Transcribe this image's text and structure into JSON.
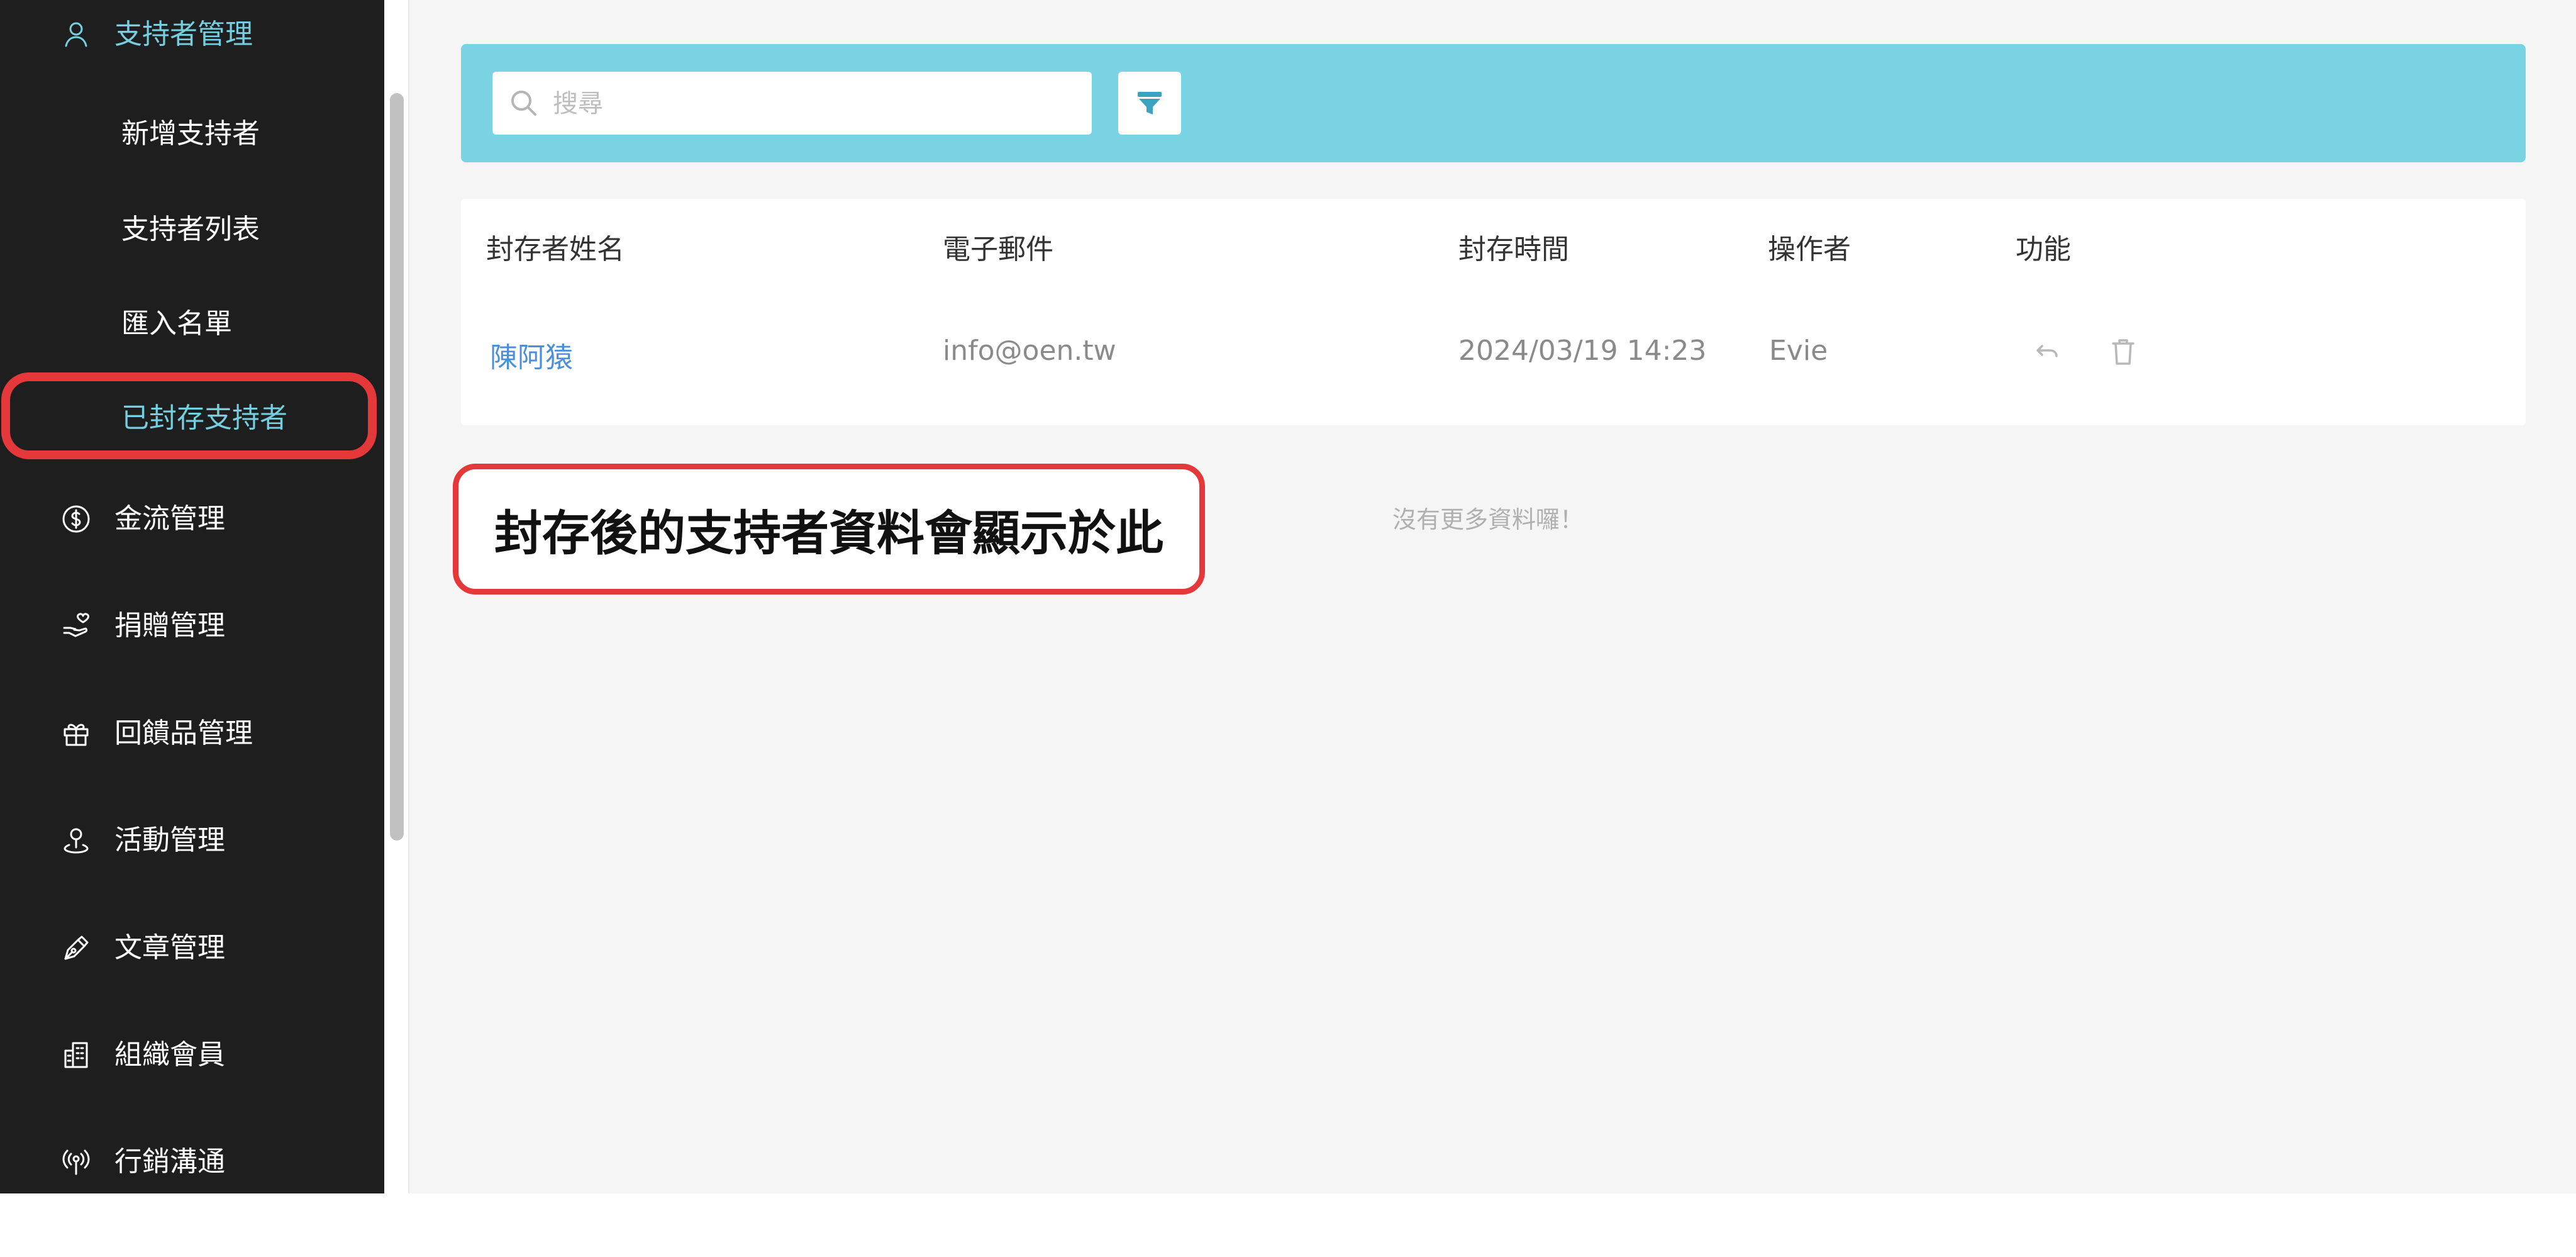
{
  "sidebar": {
    "section": {
      "label": "支持者管理",
      "icon": "user-icon",
      "active": true
    },
    "sub_items": [
      {
        "label": "新增支持者"
      },
      {
        "label": "支持者列表"
      },
      {
        "label": "匯入名單"
      },
      {
        "label": "已封存支持者",
        "active": true
      }
    ],
    "items": [
      {
        "label": "金流管理",
        "icon": "dollar-icon"
      },
      {
        "label": "捐贈管理",
        "icon": "donate-hand-icon"
      },
      {
        "label": "回饋品管理",
        "icon": "gift-icon"
      },
      {
        "label": "活動管理",
        "icon": "location-pin-icon"
      },
      {
        "label": "文章管理",
        "icon": "pen-icon"
      },
      {
        "label": "組織會員",
        "icon": "building-icon"
      },
      {
        "label": "行銷溝通",
        "icon": "broadcast-icon"
      }
    ]
  },
  "toolbar": {
    "search_placeholder": "搜尋",
    "filter_icon": "filter-icon"
  },
  "table": {
    "columns": [
      "封存者姓名",
      "電子郵件",
      "封存時間",
      "操作者",
      "功能"
    ],
    "rows": [
      {
        "name": "陳阿猿",
        "email": "info@oen.tw",
        "archived_at": "2024/03/19 14:23",
        "operator": "Evie",
        "actions": [
          "restore-icon",
          "trash-icon"
        ]
      }
    ]
  },
  "empty_message": "沒有更多資料囉！",
  "annotation": {
    "text": "封存後的支持者資料會顯示於此"
  },
  "colors": {
    "sidebar_bg": "#1e1e1e",
    "accent": "#76cfe0",
    "toolbar_bg": "#79d3e2",
    "link": "#4a8fd8",
    "highlight": "#e5383b"
  }
}
